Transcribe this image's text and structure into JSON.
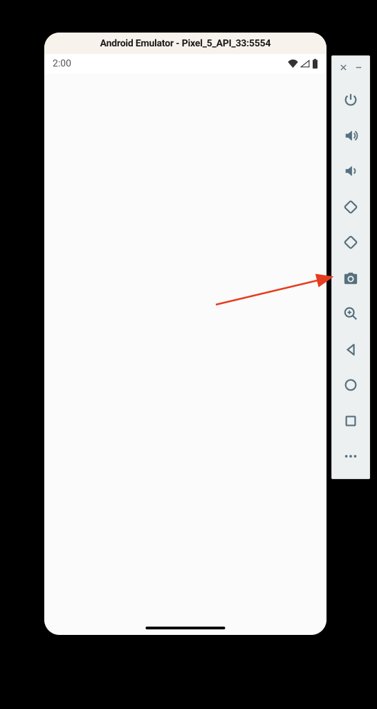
{
  "emulator": {
    "title": "Android Emulator - Pixel_5_API_33:5554"
  },
  "status_bar": {
    "time": "2:00"
  },
  "toolbar": {
    "close_label": "close",
    "minimize_label": "minimize",
    "power_label": "power",
    "volume_up_label": "volume-up",
    "volume_down_label": "volume-down",
    "rotate_left_label": "rotate-left",
    "rotate_right_label": "rotate-right",
    "screenshot_label": "screenshot",
    "zoom_label": "zoom",
    "back_label": "back",
    "home_label": "home",
    "overview_label": "overview",
    "more_label": "more"
  }
}
